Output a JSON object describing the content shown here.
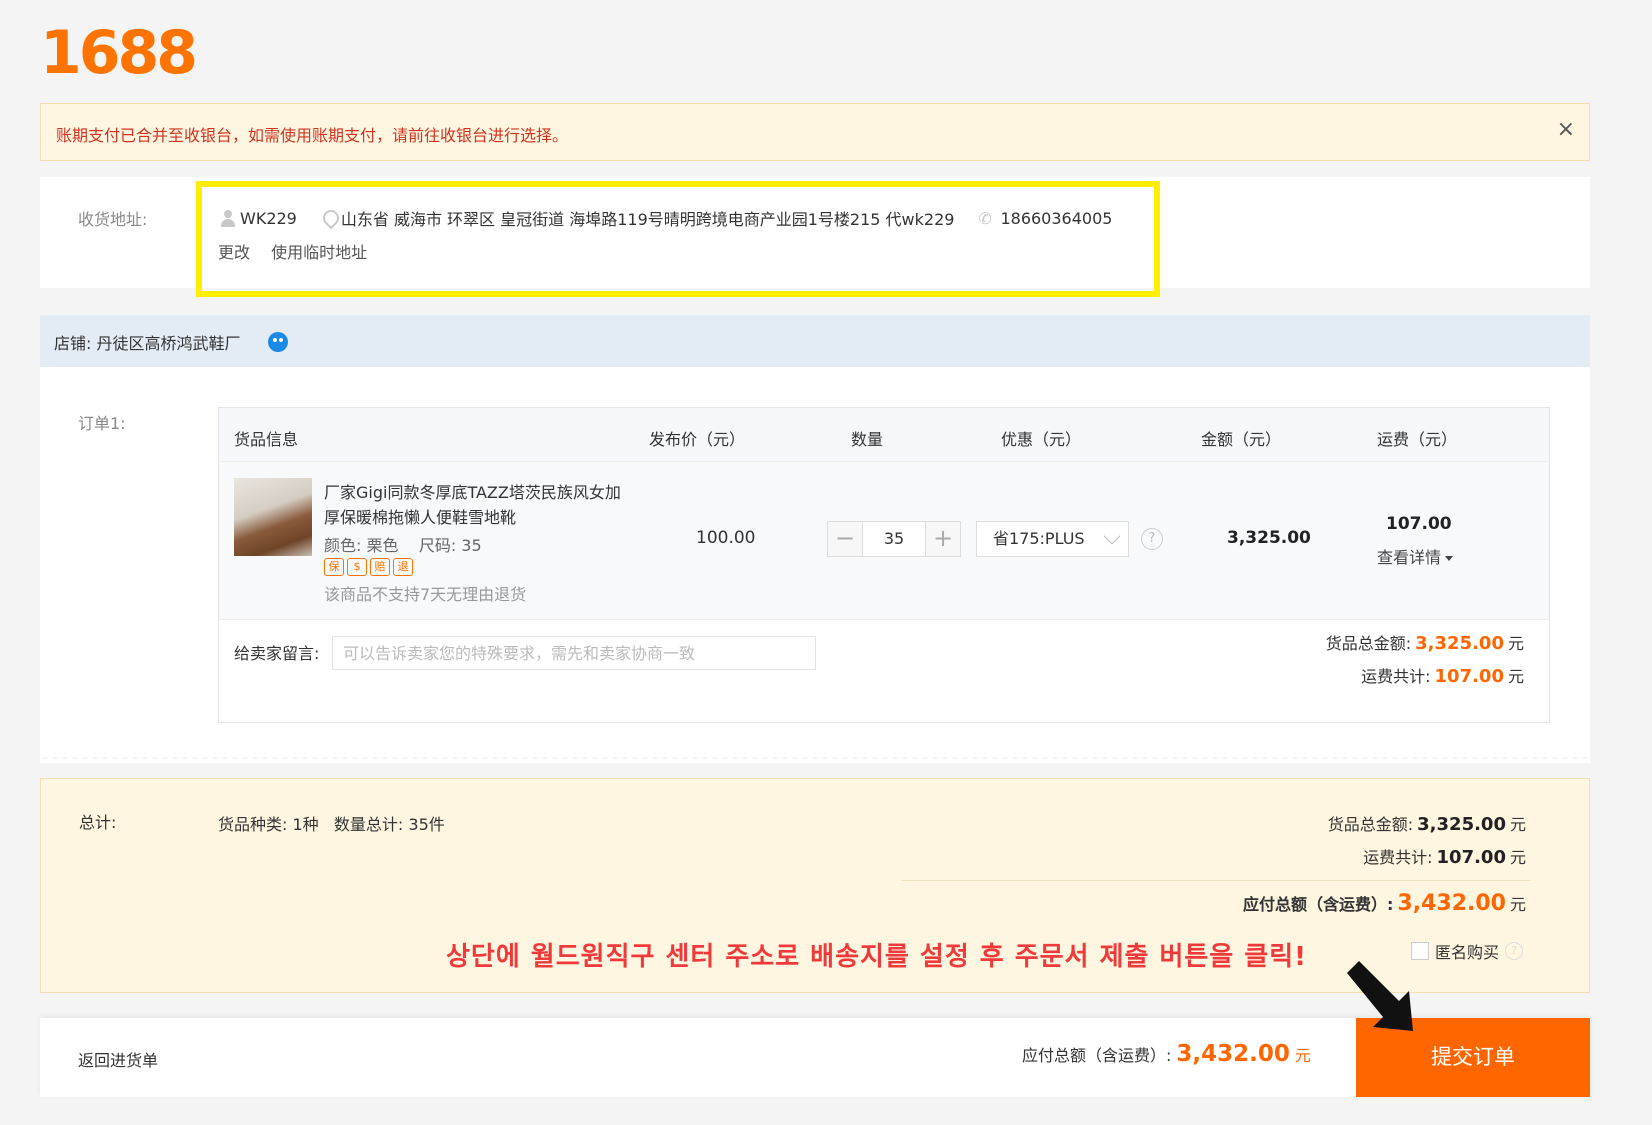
{
  "logo": "1688",
  "notice": {
    "text": "账期支付已合并至收银台，如需使用账期支付，请前往收银台进行选择。",
    "close": "×"
  },
  "address": {
    "label": "收货地址:",
    "name": "WK229",
    "full": "山东省 威海市 环翠区 皇冠街道 海埠路119号晴明跨境电商产业园1号楼215 代wk229",
    "phone": "18660364005",
    "change": "更改",
    "temp": "使用临时地址"
  },
  "shop": {
    "label": "店铺:",
    "name": "丹徒区高桥鸿武鞋厂"
  },
  "order": {
    "label": "订单1:",
    "headers": [
      "货品信息",
      "发布价（元）",
      "数量",
      "优惠（元）",
      "金额（元）",
      "运费（元）"
    ],
    "product": {
      "title": "厂家Gigi同款冬厚底TAZZ塔茨民族风女加厚保暖棉拖懒人便鞋雪地靴",
      "attrs": "颜色: 栗色    尺码: 35",
      "badges": [
        "保",
        "$",
        "赔",
        "退"
      ],
      "note": "该商品不支持7天无理由退货",
      "price": "100.00",
      "qty_minus": "−",
      "qty": "35",
      "qty_plus": "+",
      "promo": "省175:PLUS",
      "help": "?",
      "amount": "3,325.00",
      "freight": "107.00",
      "freight_detail": "查看详情"
    },
    "message_label": "给卖家留言:",
    "message_placeholder": "可以告诉卖家您的特殊要求，需先和卖家协商一致",
    "goods_total_label": "货品总金额:",
    "goods_total": "3,325.00",
    "freight_total_label": "运费共计:",
    "freight_total": "107.00",
    "unit": "元"
  },
  "totals": {
    "label": "总计:",
    "kinds": "货品种类: 1种   数量总计: 35件",
    "goods_label": "货品总金额:",
    "goods": "3,325.00",
    "freight_label": "运费共计:",
    "freight": "107.00",
    "pay_label": "应付总额（含运费）:",
    "pay": "3,432.00",
    "unit": "元",
    "anonymous": "匿名购买",
    "help": "?",
    "korean_note": "상단에 월드원직구 센터 주소로 배송지를 설정 후 주문서 제출 버튼을 클릭!"
  },
  "bottom": {
    "back": "返回进货单",
    "pay_label": "应付总额（含运费）:",
    "pay": "3,432.00",
    "unit": "元",
    "submit": "提交订单"
  },
  "colors": {
    "accent": "#ff6600",
    "highlight": "#ffee00",
    "alert_text": "#d0341d"
  }
}
